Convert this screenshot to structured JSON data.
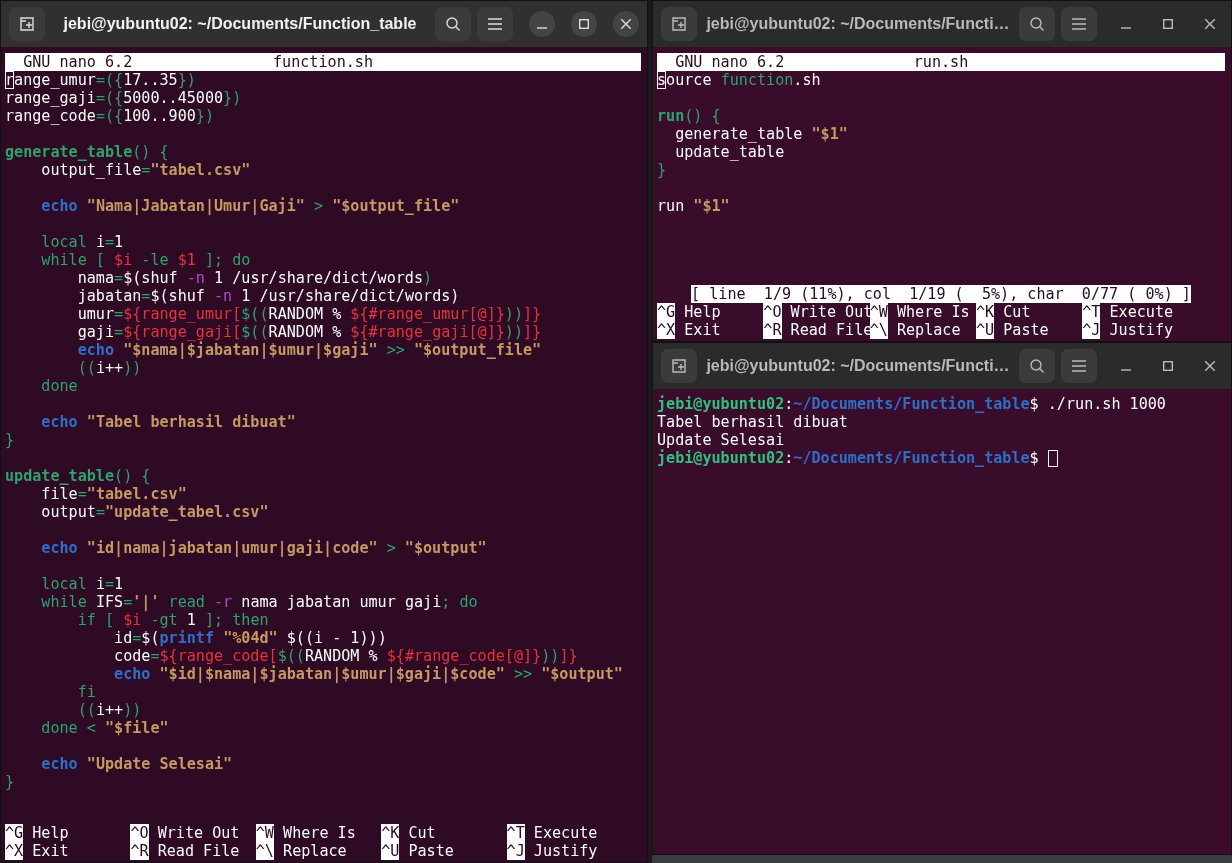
{
  "windows": [
    {
      "kind": "nano",
      "title": "jebi@yubuntu02: ~/Documents/Function_table",
      "focused": true,
      "version": "GNU nano 6.2",
      "filename": "function.sh",
      "lines": [
        {
          "segs": [
            {
              "text": "r",
              "kind": "cursor"
            },
            {
              "text": "ange_umur",
              "kind": "plain"
            },
            {
              "text": "=({",
              "kind": "kw"
            },
            {
              "text": "17..35",
              "kind": "plain"
            },
            {
              "text": "})",
              "kind": "kw"
            }
          ]
        },
        {
          "segs": [
            {
              "text": "range_gaji",
              "kind": "plain"
            },
            {
              "text": "=({",
              "kind": "kw"
            },
            {
              "text": "5000..45000",
              "kind": "plain"
            },
            {
              "text": "})",
              "kind": "kw"
            }
          ]
        },
        {
          "segs": [
            {
              "text": "range_code",
              "kind": "plain"
            },
            {
              "text": "=({",
              "kind": "kw"
            },
            {
              "text": "100..900",
              "kind": "plain"
            },
            {
              "text": "})",
              "kind": "kw"
            }
          ]
        },
        {
          "gap_before": true,
          "segs": [
            {
              "text": "generate_table",
              "kind": "func"
            },
            {
              "text": "() {",
              "kind": "kw"
            }
          ]
        },
        {
          "segs": [
            {
              "text": "    output_file",
              "kind": "plain"
            },
            {
              "text": "=",
              "kind": "kw"
            },
            {
              "text": "\"tabel.csv\"",
              "kind": "str"
            }
          ]
        },
        {
          "gap_before": true,
          "segs": [
            {
              "text": "    echo",
              "kind": "builtin"
            },
            {
              "text": " \"Nama|Jabatan|Umur|Gaji\"",
              "kind": "str"
            },
            {
              "text": " > ",
              "kind": "kw"
            },
            {
              "text": "\"$output_file\"",
              "kind": "str"
            }
          ]
        },
        {
          "gap_before": true,
          "segs": [
            {
              "text": "    local ",
              "kind": "kw"
            },
            {
              "text": "i",
              "kind": "plain"
            },
            {
              "text": "=",
              "kind": "kw"
            },
            {
              "text": "1",
              "kind": "plain"
            }
          ]
        },
        {
          "segs": [
            {
              "text": "    while [ ",
              "kind": "kw"
            },
            {
              "text": "$i",
              "kind": "var"
            },
            {
              "text": " -le ",
              "kind": "kw"
            },
            {
              "text": "$1",
              "kind": "var"
            },
            {
              "text": " ]; do",
              "kind": "kw"
            }
          ]
        },
        {
          "segs": [
            {
              "text": "        nama",
              "kind": "plain"
            },
            {
              "text": "=",
              "kind": "kw"
            },
            {
              "text": "$(shuf ",
              "kind": "plain"
            },
            {
              "text": "-n",
              "kind": "flag"
            },
            {
              "text": " 1 /usr/share/dict/words",
              "kind": "plain"
            },
            {
              "text": ")",
              "kind": "kw"
            }
          ]
        },
        {
          "segs": [
            {
              "text": "        jabatan",
              "kind": "plain"
            },
            {
              "text": "=",
              "kind": "kw"
            },
            {
              "text": "$(shuf ",
              "kind": "plain"
            },
            {
              "text": "-n",
              "kind": "flag"
            },
            {
              "text": " 1 /usr/share/dict/words)",
              "kind": "plain"
            }
          ]
        },
        {
          "segs": [
            {
              "text": "        umur",
              "kind": "plain"
            },
            {
              "text": "=",
              "kind": "kw"
            },
            {
              "text": "${range_umur[",
              "kind": "var"
            },
            {
              "text": "$((",
              "kind": "kw"
            },
            {
              "text": "RANDOM % ",
              "kind": "plain"
            },
            {
              "text": "${#range_umur[@]}",
              "kind": "var"
            },
            {
              "text": "))",
              "kind": "kw"
            },
            {
              "text": "]}",
              "kind": "var"
            }
          ]
        },
        {
          "segs": [
            {
              "text": "        gaji",
              "kind": "plain"
            },
            {
              "text": "=",
              "kind": "kw"
            },
            {
              "text": "${range_gaji[",
              "kind": "var"
            },
            {
              "text": "$((",
              "kind": "kw"
            },
            {
              "text": "RANDOM % ",
              "kind": "plain"
            },
            {
              "text": "${#range_gaji[@]}",
              "kind": "var"
            },
            {
              "text": "))",
              "kind": "kw"
            },
            {
              "text": "]}",
              "kind": "var"
            }
          ]
        },
        {
          "segs": [
            {
              "text": "        echo",
              "kind": "builtin"
            },
            {
              "text": " \"$nama|$jabatan|$umur|$gaji\"",
              "kind": "str"
            },
            {
              "text": " >> ",
              "kind": "kw"
            },
            {
              "text": "\"$output_file\"",
              "kind": "str"
            }
          ]
        },
        {
          "segs": [
            {
              "text": "        ((",
              "kind": "kw"
            },
            {
              "text": "i++",
              "kind": "plain"
            },
            {
              "text": "))",
              "kind": "kw"
            }
          ]
        },
        {
          "segs": [
            {
              "text": "    done",
              "kind": "kw"
            }
          ]
        },
        {
          "gap_before": true,
          "segs": [
            {
              "text": "    echo",
              "kind": "builtin"
            },
            {
              "text": " \"Tabel berhasil dibuat\"",
              "kind": "str"
            }
          ]
        },
        {
          "segs": [
            {
              "text": "}",
              "kind": "kw"
            }
          ]
        },
        {
          "gap_before": true,
          "segs": [
            {
              "text": "update_table",
              "kind": "func"
            },
            {
              "text": "() {",
              "kind": "kw"
            }
          ]
        },
        {
          "segs": [
            {
              "text": "    file",
              "kind": "plain"
            },
            {
              "text": "=",
              "kind": "kw"
            },
            {
              "text": "\"tabel.csv\"",
              "kind": "str"
            }
          ]
        },
        {
          "segs": [
            {
              "text": "    output",
              "kind": "plain"
            },
            {
              "text": "=",
              "kind": "kw"
            },
            {
              "text": "\"update_tabel.csv\"",
              "kind": "str"
            }
          ]
        },
        {
          "gap_before": true,
          "segs": [
            {
              "text": "    echo",
              "kind": "builtin"
            },
            {
              "text": " \"id|nama|jabatan|umur|gaji|code\"",
              "kind": "str"
            },
            {
              "text": " > ",
              "kind": "kw"
            },
            {
              "text": "\"$output\"",
              "kind": "str"
            }
          ]
        },
        {
          "gap_before": true,
          "segs": [
            {
              "text": "    local ",
              "kind": "kw"
            },
            {
              "text": "i",
              "kind": "plain"
            },
            {
              "text": "=",
              "kind": "kw"
            },
            {
              "text": "1",
              "kind": "plain"
            }
          ]
        },
        {
          "segs": [
            {
              "text": "    while ",
              "kind": "kw"
            },
            {
              "text": "IFS",
              "kind": "plain"
            },
            {
              "text": "=",
              "kind": "kw"
            },
            {
              "text": "'|'",
              "kind": "str"
            },
            {
              "text": " read ",
              "kind": "kw"
            },
            {
              "text": "-r",
              "kind": "flag"
            },
            {
              "text": " nama jabatan umur gaji",
              "kind": "plain"
            },
            {
              "text": "; do",
              "kind": "kw"
            }
          ]
        },
        {
          "segs": [
            {
              "text": "        if [ ",
              "kind": "kw"
            },
            {
              "text": "$i",
              "kind": "var"
            },
            {
              "text": " -gt ",
              "kind": "kw"
            },
            {
              "text": "1",
              "kind": "plain"
            },
            {
              "text": " ]; then",
              "kind": "kw"
            }
          ]
        },
        {
          "segs": [
            {
              "text": "            id",
              "kind": "plain"
            },
            {
              "text": "=",
              "kind": "kw"
            },
            {
              "text": "$(",
              "kind": "plain"
            },
            {
              "text": "printf",
              "kind": "builtin"
            },
            {
              "text": " \"%04d\"",
              "kind": "str"
            },
            {
              "text": " $((i - 1)))",
              "kind": "plain"
            }
          ]
        },
        {
          "segs": [
            {
              "text": "            code",
              "kind": "plain"
            },
            {
              "text": "=",
              "kind": "kw"
            },
            {
              "text": "${range_code[",
              "kind": "var"
            },
            {
              "text": "$((",
              "kind": "kw"
            },
            {
              "text": "RANDOM % ",
              "kind": "plain"
            },
            {
              "text": "${#range_code[@]}",
              "kind": "var"
            },
            {
              "text": "))",
              "kind": "kw"
            },
            {
              "text": "]}",
              "kind": "var"
            }
          ]
        },
        {
          "segs": [
            {
              "text": "            echo",
              "kind": "builtin"
            },
            {
              "text": " \"$id|$nama|$jabatan|$umur|$gaji|$code\"",
              "kind": "str"
            },
            {
              "text": " >> ",
              "kind": "kw"
            },
            {
              "text": "\"$output\"",
              "kind": "str"
            }
          ]
        },
        {
          "segs": [
            {
              "text": "        fi",
              "kind": "kw"
            }
          ]
        },
        {
          "segs": [
            {
              "text": "        ((",
              "kind": "kw"
            },
            {
              "text": "i++",
              "kind": "plain"
            },
            {
              "text": "))",
              "kind": "kw"
            }
          ]
        },
        {
          "segs": [
            {
              "text": "    done < ",
              "kind": "kw"
            },
            {
              "text": "\"$file\"",
              "kind": "str"
            }
          ]
        },
        {
          "gap_before": true,
          "segs": [
            {
              "text": "    echo",
              "kind": "builtin"
            },
            {
              "text": " \"Update Selesai\"",
              "kind": "str"
            }
          ]
        },
        {
          "segs": [
            {
              "text": "}",
              "kind": "kw"
            }
          ]
        }
      ],
      "shortcuts": [
        [
          {
            "key": "^G",
            "label": "Help"
          },
          {
            "key": "^O",
            "label": "Write Out"
          },
          {
            "key": "^W",
            "label": "Where Is"
          },
          {
            "key": "^K",
            "label": "Cut"
          },
          {
            "key": "^T",
            "label": "Execute"
          }
        ],
        [
          {
            "key": "^X",
            "label": "Exit"
          },
          {
            "key": "^R",
            "label": "Read File"
          },
          {
            "key": "^\\",
            "label": "Replace"
          },
          {
            "key": "^U",
            "label": "Paste"
          },
          {
            "key": "^J",
            "label": "Justify"
          }
        ]
      ]
    },
    {
      "kind": "nano",
      "title": "jebi@yubuntu02: ~/Documents/Functi…",
      "focused": false,
      "version": "GNU nano 6.2",
      "filename": "run.sh",
      "lines": [
        {
          "segs": [
            {
              "text": "s",
              "kind": "cursor"
            },
            {
              "text": "ource ",
              "kind": "plain"
            },
            {
              "text": "function",
              "kind": "kw"
            },
            {
              "text": ".sh",
              "kind": "plain"
            }
          ]
        },
        {
          "gap_before": true,
          "segs": [
            {
              "text": "run",
              "kind": "func"
            },
            {
              "text": "() {",
              "kind": "kw"
            }
          ]
        },
        {
          "segs": [
            {
              "text": "  generate_table ",
              "kind": "plain"
            },
            {
              "text": "\"$1\"",
              "kind": "str"
            }
          ]
        },
        {
          "segs": [
            {
              "text": "  update_table",
              "kind": "plain"
            }
          ]
        },
        {
          "segs": [
            {
              "text": "}",
              "kind": "kw"
            }
          ]
        },
        {
          "gap_before": true,
          "segs": [
            {
              "text": "run ",
              "kind": "plain"
            },
            {
              "text": "\"$1\"",
              "kind": "str"
            }
          ]
        }
      ],
      "status": "[ line  1/9 (11%), col  1/19 (  5%), char  0/77 ( 0%) ]",
      "shortcuts": [
        [
          {
            "key": "^G",
            "label": "Help"
          },
          {
            "key": "^O",
            "label": "Write Out"
          },
          {
            "key": "^W",
            "label": "Where Is"
          },
          {
            "key": "^K",
            "label": "Cut"
          },
          {
            "key": "^T",
            "label": "Execute"
          }
        ],
        [
          {
            "key": "^X",
            "label": "Exit"
          },
          {
            "key": "^R",
            "label": "Read File"
          },
          {
            "key": "^\\",
            "label": "Replace"
          },
          {
            "key": "^U",
            "label": "Paste"
          },
          {
            "key": "^J",
            "label": "Justify"
          }
        ]
      ]
    },
    {
      "kind": "terminal",
      "title": "jebi@yubuntu02: ~/Documents/Functi…",
      "focused": false,
      "lines": [
        {
          "segs": [
            {
              "text": "jebi@yubuntu02",
              "kind": "user"
            },
            {
              "text": ":",
              "kind": "plain"
            },
            {
              "text": "~/Documents/Function_table",
              "kind": "path"
            },
            {
              "text": "$ ./run.sh 1000",
              "kind": "plain"
            }
          ]
        },
        {
          "segs": [
            {
              "text": "Tabel berhasil dibuat",
              "kind": "plain"
            }
          ]
        },
        {
          "segs": [
            {
              "text": "Update Selesai",
              "kind": "plain"
            }
          ]
        },
        {
          "segs": [
            {
              "text": "jebi@yubuntu02",
              "kind": "user"
            },
            {
              "text": ":",
              "kind": "plain"
            },
            {
              "text": "~/Documents/Function_table",
              "kind": "path"
            },
            {
              "text": "$",
              "kind": "plain"
            }
          ]
        }
      ],
      "cursor": true
    }
  ]
}
